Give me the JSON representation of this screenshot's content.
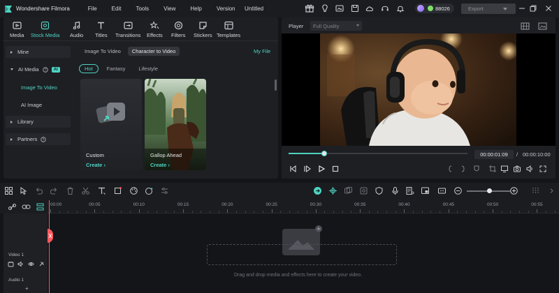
{
  "app": {
    "name": "Wondershare Filmora",
    "menu": [
      "File",
      "Edit",
      "Tools",
      "View",
      "Help",
      "Version"
    ],
    "doc_title": "Untitled",
    "credits": "88026",
    "export_label": "Export"
  },
  "toolbar": {
    "tools": [
      {
        "label": "Media",
        "icon": "media-icon"
      },
      {
        "label": "Stock Media",
        "icon": "stock-media-icon",
        "active": true
      },
      {
        "label": "Audio",
        "icon": "audio-icon"
      },
      {
        "label": "Titles",
        "icon": "titles-icon"
      },
      {
        "label": "Transitions",
        "icon": "transitions-icon"
      },
      {
        "label": "Effects",
        "icon": "effects-icon"
      },
      {
        "label": "Filters",
        "icon": "filters-icon"
      },
      {
        "label": "Stickers",
        "icon": "stickers-icon"
      },
      {
        "label": "Templates",
        "icon": "templates-icon"
      }
    ]
  },
  "sidebar": {
    "mine": "Mine",
    "ai_media": "AI Media",
    "ai_badge": "AI",
    "image_to_video": "Image To Video",
    "ai_image": "AI Image",
    "library": "Library",
    "partners": "Partners"
  },
  "content": {
    "tabs": [
      "Image To Video",
      "Character to Video"
    ],
    "my_file": "My File",
    "chips": [
      "Hot",
      "Fantasy",
      "Lifestyle"
    ],
    "cards": [
      {
        "title": "Custom",
        "action": "Create"
      },
      {
        "title": "Gallop Ahead",
        "action": "Create"
      }
    ]
  },
  "player": {
    "label": "Player",
    "quality": "Full Quality",
    "current_time": "00:00:01:09",
    "separator": "/",
    "total_time": "00:00:10:00",
    "progress": 0.2
  },
  "timeline": {
    "ruler": [
      "00:00",
      "00:05",
      "00:10",
      "00:15",
      "00:20",
      "00:25",
      "00:30",
      "00:35",
      "00:40",
      "00:45",
      "00:50",
      "00:55"
    ],
    "video_track": "Video 1",
    "audio_track": "Audio 1",
    "drop_hint": "Drag and drop media and effects here to create your video.",
    "zoom": 0.52
  },
  "colors": {
    "accent": "#4ed4c2",
    "playhead": "#ff5a5f",
    "panel": "#1e1f23",
    "background": "#141519"
  }
}
